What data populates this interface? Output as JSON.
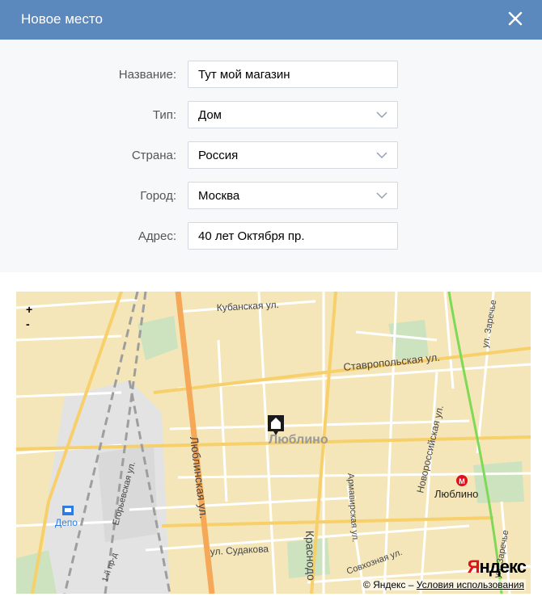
{
  "dialog": {
    "title": "Новое место",
    "close_icon": "close-icon",
    "header_color": "#5b88bd"
  },
  "form": {
    "fields": [
      {
        "label": "Название:",
        "value": "Тут мой магазин",
        "kind": "text"
      },
      {
        "label": "Тип:",
        "value": "Дом",
        "kind": "select"
      },
      {
        "label": "Страна:",
        "value": "Россия",
        "kind": "select"
      },
      {
        "label": "Город:",
        "value": "Москва",
        "kind": "select"
      },
      {
        "label": "Адрес:",
        "value": "40 лет Октября пр.",
        "kind": "text"
      }
    ]
  },
  "map": {
    "zoom_in": "+",
    "zoom_out": "-",
    "district": "Люблино",
    "metro": "Люблино",
    "depot": "Депо",
    "streets": {
      "kubanskaya": "Кубанская ул.",
      "stavropolskaya": "Ставропольская ул.",
      "lyublinskaya": "Люблинская ул.",
      "egorievskaya": "Егорьевская ул.",
      "armavirskaya": "Армавирская ул.",
      "novorossiyskaya": "Новороссийская ул.",
      "sudakova": "ул. Судакова",
      "krasnodonskaya": "Краснодо",
      "sovkhoznaya": "Совхозная ул.",
      "zarechye": "ул. Заречье",
      "one_proezd": "1-й пр-д"
    },
    "marker_icon": "house-marker-icon",
    "metro_icon": "metro-icon",
    "logo": "Яндекс",
    "copyright": "© Яндекс –",
    "terms_link": "Условия использования"
  }
}
